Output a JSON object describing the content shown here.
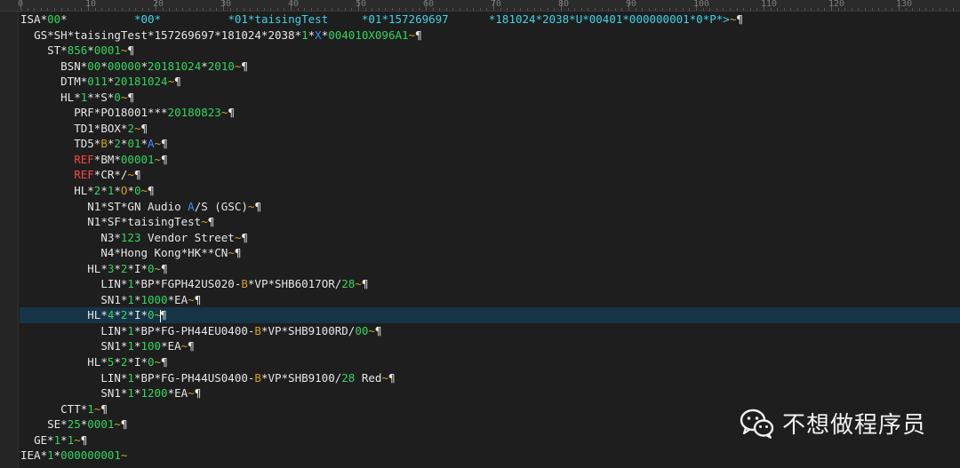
{
  "ruler": {
    "labels": [
      "0",
      "10",
      "20",
      "30",
      "40",
      "50",
      "60",
      "70",
      "80",
      "90",
      "100",
      "110",
      "120",
      "130"
    ]
  },
  "colors": {
    "background": "#1e1e1e",
    "segment_text": "#e6e6e6",
    "number": "#2fd65e",
    "terminator": "#d4a017",
    "isa_value": "#3fd3e6",
    "ref_keyword": "#f04848",
    "qualifier": "#3a8eff",
    "current_line": "#163446"
  },
  "icons": {
    "paragraph_mark": "¶",
    "wechat_logo": "wechat-icon"
  },
  "editor": {
    "current_line_index": 19,
    "lines": [
      {
        "indent": "",
        "tokens": [
          [
            "ISA*",
            "s"
          ],
          [
            "00",
            "n"
          ],
          [
            "*          ",
            "s"
          ],
          [
            "*00*",
            "i"
          ],
          [
            "          ",
            "s"
          ],
          [
            "*01*taisingTest",
            "i"
          ],
          [
            "     ",
            "s"
          ],
          [
            "*01*157269697",
            "i"
          ],
          [
            "      ",
            "s"
          ],
          [
            "*181024*2038*U*00401*000000001*0*P*>",
            "i"
          ],
          [
            "~",
            "t"
          ],
          [
            "¶",
            "s"
          ]
        ]
      },
      {
        "indent": "  ",
        "tokens": [
          [
            "GS*SH*taisingTest*157269697*181024*2038*",
            "s"
          ],
          [
            "1",
            "n"
          ],
          [
            "*",
            "s"
          ],
          [
            "X",
            "b"
          ],
          [
            "*",
            "s"
          ],
          [
            "004010X096A1",
            "n"
          ],
          [
            "~",
            "t"
          ],
          [
            "¶",
            "s"
          ]
        ]
      },
      {
        "indent": "    ",
        "tokens": [
          [
            "ST*",
            "s"
          ],
          [
            "856",
            "n"
          ],
          [
            "*",
            "s"
          ],
          [
            "0001",
            "n"
          ],
          [
            "~",
            "t"
          ],
          [
            "¶",
            "s"
          ]
        ]
      },
      {
        "indent": "      ",
        "tokens": [
          [
            "BSN*",
            "s"
          ],
          [
            "00",
            "n"
          ],
          [
            "*",
            "s"
          ],
          [
            "00000",
            "n"
          ],
          [
            "*",
            "s"
          ],
          [
            "20181024",
            "n"
          ],
          [
            "*",
            "s"
          ],
          [
            "2010",
            "n"
          ],
          [
            "~",
            "t"
          ],
          [
            "¶",
            "s"
          ]
        ]
      },
      {
        "indent": "      ",
        "tokens": [
          [
            "DTM*",
            "s"
          ],
          [
            "011",
            "n"
          ],
          [
            "*",
            "s"
          ],
          [
            "20181024",
            "n"
          ],
          [
            "~",
            "t"
          ],
          [
            "¶",
            "s"
          ]
        ]
      },
      {
        "indent": "      ",
        "tokens": [
          [
            "HL*",
            "s"
          ],
          [
            "1",
            "n"
          ],
          [
            "**S*",
            "s"
          ],
          [
            "0",
            "n"
          ],
          [
            "~",
            "t"
          ],
          [
            "¶",
            "s"
          ]
        ]
      },
      {
        "indent": "        ",
        "tokens": [
          [
            "PRF*PO18001***",
            "s"
          ],
          [
            "20180823",
            "n"
          ],
          [
            "~",
            "t"
          ],
          [
            "¶",
            "s"
          ]
        ]
      },
      {
        "indent": "        ",
        "tokens": [
          [
            "TD1*BOX*",
            "s"
          ],
          [
            "2",
            "n"
          ],
          [
            "~",
            "t"
          ],
          [
            "¶",
            "s"
          ]
        ]
      },
      {
        "indent": "        ",
        "tokens": [
          [
            "TD5*",
            "s"
          ],
          [
            "B",
            "t"
          ],
          [
            "*",
            "s"
          ],
          [
            "2",
            "n"
          ],
          [
            "*",
            "s"
          ],
          [
            "01",
            "n"
          ],
          [
            "*",
            "s"
          ],
          [
            "A",
            "b"
          ],
          [
            "~",
            "t"
          ],
          [
            "¶",
            "s"
          ]
        ]
      },
      {
        "indent": "        ",
        "tokens": [
          [
            "REF",
            "r"
          ],
          [
            "*BM*",
            "s"
          ],
          [
            "00001",
            "n"
          ],
          [
            "~",
            "t"
          ],
          [
            "¶",
            "s"
          ]
        ]
      },
      {
        "indent": "        ",
        "tokens": [
          [
            "REF",
            "r"
          ],
          [
            "*CR*/",
            "s"
          ],
          [
            "~",
            "t"
          ],
          [
            "¶",
            "s"
          ]
        ]
      },
      {
        "indent": "        ",
        "tokens": [
          [
            "HL*",
            "s"
          ],
          [
            "2",
            "n"
          ],
          [
            "*",
            "s"
          ],
          [
            "1",
            "n"
          ],
          [
            "*",
            "s"
          ],
          [
            "O",
            "t"
          ],
          [
            "*",
            "s"
          ],
          [
            "0",
            "n"
          ],
          [
            "~",
            "t"
          ],
          [
            "¶",
            "s"
          ]
        ]
      },
      {
        "indent": "          ",
        "tokens": [
          [
            "N1*ST*GN Audio ",
            "s"
          ],
          [
            "A",
            "b"
          ],
          [
            "/S (GSC)",
            "s"
          ],
          [
            "~",
            "t"
          ],
          [
            "¶",
            "s"
          ]
        ]
      },
      {
        "indent": "          ",
        "tokens": [
          [
            "N1*SF*taisingTest",
            "s"
          ],
          [
            "~",
            "t"
          ],
          [
            "¶",
            "s"
          ]
        ]
      },
      {
        "indent": "            ",
        "tokens": [
          [
            "N3*",
            "s"
          ],
          [
            "123",
            "n"
          ],
          [
            " Vendor Street",
            "s"
          ],
          [
            "~",
            "t"
          ],
          [
            "¶",
            "s"
          ]
        ]
      },
      {
        "indent": "            ",
        "tokens": [
          [
            "N4*Hong Kong*HK**CN",
            "s"
          ],
          [
            "~",
            "t"
          ],
          [
            "¶",
            "s"
          ]
        ]
      },
      {
        "indent": "          ",
        "tokens": [
          [
            "HL*",
            "s"
          ],
          [
            "3",
            "n"
          ],
          [
            "*",
            "s"
          ],
          [
            "2",
            "n"
          ],
          [
            "*I*",
            "s"
          ],
          [
            "0",
            "n"
          ],
          [
            "~",
            "t"
          ],
          [
            "¶",
            "s"
          ]
        ]
      },
      {
        "indent": "            ",
        "tokens": [
          [
            "LIN*",
            "s"
          ],
          [
            "1",
            "n"
          ],
          [
            "*BP*FGPH42US020-",
            "s"
          ],
          [
            "B",
            "t"
          ],
          [
            "*VP*SHB6017OR/",
            "s"
          ],
          [
            "28",
            "n"
          ],
          [
            "~",
            "t"
          ],
          [
            "¶",
            "s"
          ]
        ]
      },
      {
        "indent": "            ",
        "tokens": [
          [
            "SN1*",
            "s"
          ],
          [
            "1",
            "n"
          ],
          [
            "*",
            "s"
          ],
          [
            "1000",
            "n"
          ],
          [
            "*EA",
            "s"
          ],
          [
            "~",
            "t"
          ],
          [
            "¶",
            "s"
          ]
        ]
      },
      {
        "indent": "          ",
        "tokens": [
          [
            "HL*",
            "s"
          ],
          [
            "4",
            "n"
          ],
          [
            "*",
            "s"
          ],
          [
            "2",
            "n"
          ],
          [
            "*I*",
            "s"
          ],
          [
            "0",
            "n"
          ],
          [
            "~",
            "t"
          ],
          [
            "|",
            "c"
          ],
          [
            "¶",
            "s"
          ]
        ]
      },
      {
        "indent": "            ",
        "tokens": [
          [
            "LIN*",
            "s"
          ],
          [
            "1",
            "n"
          ],
          [
            "*BP*FG-PH44EU0400-",
            "s"
          ],
          [
            "B",
            "t"
          ],
          [
            "*VP*SHB9100RD/",
            "s"
          ],
          [
            "00",
            "n"
          ],
          [
            "~",
            "t"
          ],
          [
            "¶",
            "s"
          ]
        ]
      },
      {
        "indent": "            ",
        "tokens": [
          [
            "SN1*",
            "s"
          ],
          [
            "1",
            "n"
          ],
          [
            "*",
            "s"
          ],
          [
            "100",
            "n"
          ],
          [
            "*EA",
            "s"
          ],
          [
            "~",
            "t"
          ],
          [
            "¶",
            "s"
          ]
        ]
      },
      {
        "indent": "          ",
        "tokens": [
          [
            "HL*",
            "s"
          ],
          [
            "5",
            "n"
          ],
          [
            "*",
            "s"
          ],
          [
            "2",
            "n"
          ],
          [
            "*I*",
            "s"
          ],
          [
            "0",
            "n"
          ],
          [
            "~",
            "t"
          ],
          [
            "¶",
            "s"
          ]
        ]
      },
      {
        "indent": "            ",
        "tokens": [
          [
            "LIN*",
            "s"
          ],
          [
            "1",
            "n"
          ],
          [
            "*BP*FG-PH44US0400-",
            "s"
          ],
          [
            "B",
            "t"
          ],
          [
            "*VP*SHB9100/",
            "s"
          ],
          [
            "28",
            "n"
          ],
          [
            " Red",
            "s"
          ],
          [
            "~",
            "t"
          ],
          [
            "¶",
            "s"
          ]
        ]
      },
      {
        "indent": "            ",
        "tokens": [
          [
            "SN1*",
            "s"
          ],
          [
            "1",
            "n"
          ],
          [
            "*",
            "s"
          ],
          [
            "1200",
            "n"
          ],
          [
            "*EA",
            "s"
          ],
          [
            "~",
            "t"
          ],
          [
            "¶",
            "s"
          ]
        ]
      },
      {
        "indent": "      ",
        "tokens": [
          [
            "CTT*",
            "s"
          ],
          [
            "1",
            "n"
          ],
          [
            "~",
            "t"
          ],
          [
            "¶",
            "s"
          ]
        ]
      },
      {
        "indent": "    ",
        "tokens": [
          [
            "SE*",
            "s"
          ],
          [
            "25",
            "n"
          ],
          [
            "*",
            "s"
          ],
          [
            "0001",
            "n"
          ],
          [
            "~",
            "t"
          ],
          [
            "¶",
            "s"
          ]
        ]
      },
      {
        "indent": "  ",
        "tokens": [
          [
            "GE*",
            "s"
          ],
          [
            "1",
            "n"
          ],
          [
            "*",
            "s"
          ],
          [
            "1",
            "n"
          ],
          [
            "~",
            "t"
          ],
          [
            "¶",
            "s"
          ]
        ]
      },
      {
        "indent": "",
        "tokens": [
          [
            "IEA*",
            "s"
          ],
          [
            "1",
            "n"
          ],
          [
            "*",
            "s"
          ],
          [
            "000000001",
            "n"
          ],
          [
            "~",
            "t"
          ]
        ]
      }
    ]
  },
  "watermark": {
    "text": "不想做程序员"
  }
}
